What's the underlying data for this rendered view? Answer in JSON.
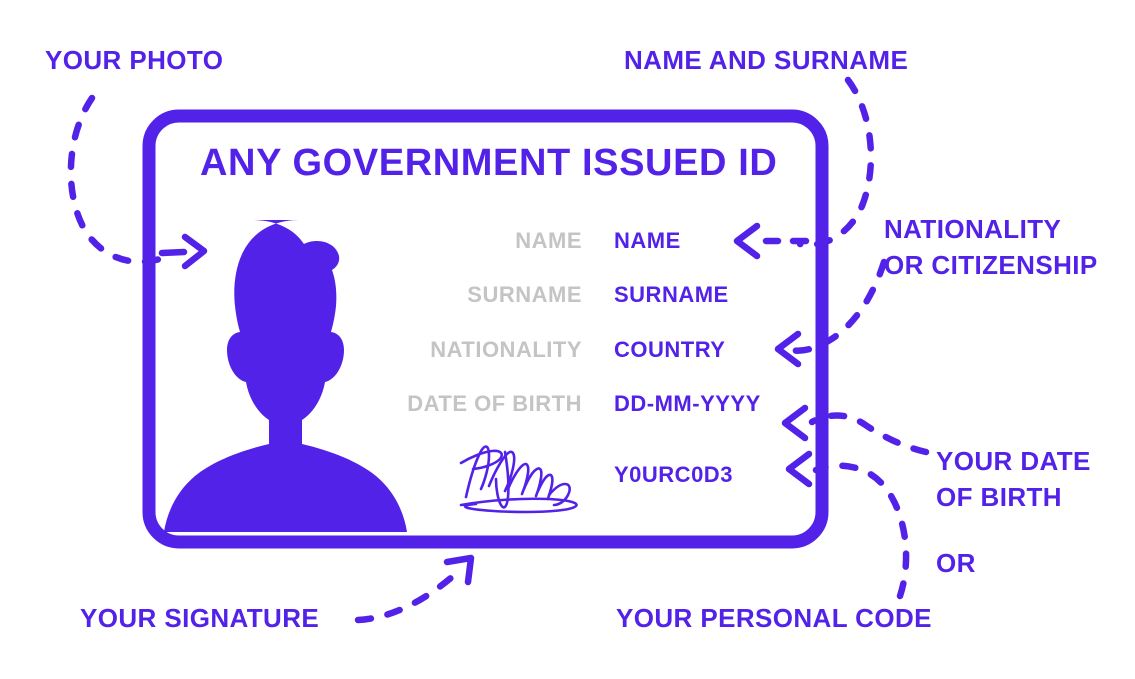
{
  "accent_color": "#5322e8",
  "label_color": "#c4c4c4",
  "background_color": "#ffffff",
  "card": {
    "title": "ANY GOVERNMENT ISSUED ID",
    "photo_alt": "person-silhouette",
    "signature_alt": "handwritten-signature",
    "fields": [
      {
        "label": "NAME",
        "value": "NAME"
      },
      {
        "label": "SURNAME",
        "value": "SURNAME"
      },
      {
        "label": "NATIONALITY",
        "value": "COUNTRY"
      },
      {
        "label": "DATE OF BIRTH",
        "value": "DD-MM-YYYY"
      },
      {
        "label": "",
        "value": "Y0URC0D3"
      }
    ]
  },
  "annotations": {
    "photo": "YOUR PHOTO",
    "name_and_surname": "NAME AND SURNAME",
    "nationality": "NATIONALITY\nOR CITIZENSHIP",
    "date_of_birth": "YOUR DATE\nOF BIRTH",
    "or": "OR",
    "signature": "YOUR SIGNATURE",
    "personal_code": "YOUR PERSONAL CODE"
  }
}
